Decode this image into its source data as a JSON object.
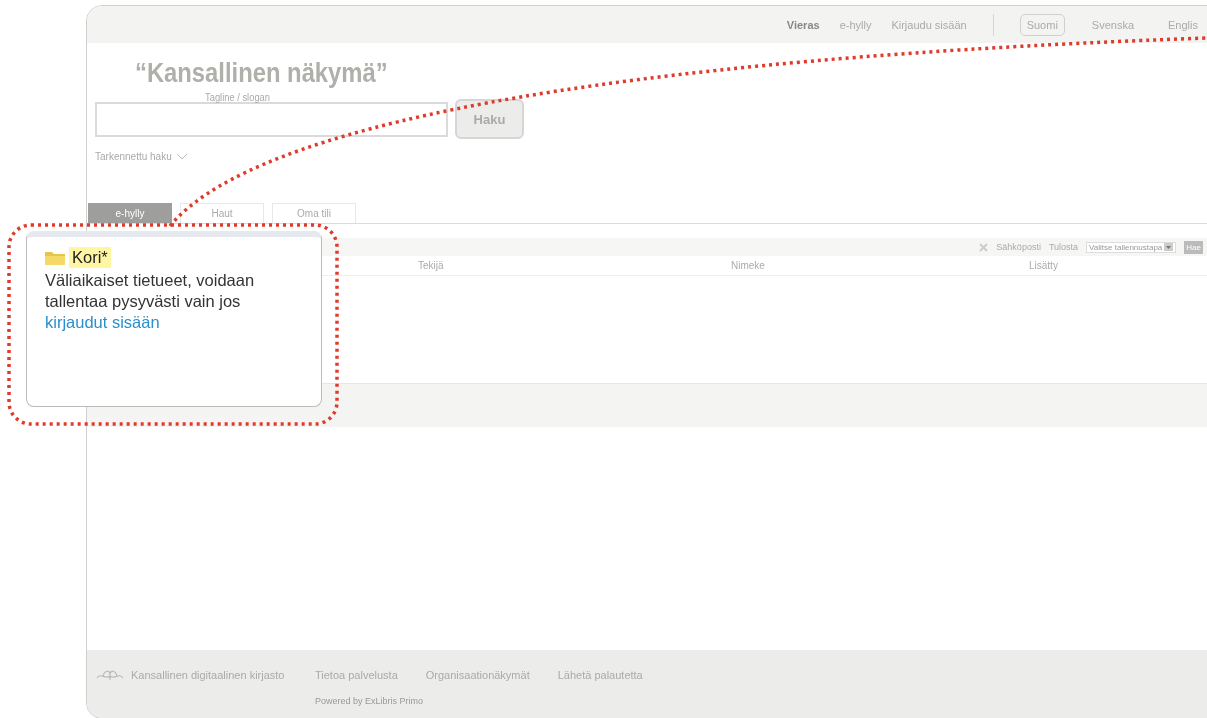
{
  "top_bar": {
    "links": [
      {
        "label": "Vieras",
        "kind": "user"
      },
      {
        "label": "e-hylly",
        "kind": "link"
      },
      {
        "label": "Kirjaudu sisään",
        "kind": "link"
      }
    ],
    "languages": [
      {
        "label": "Suomi",
        "selected": true
      },
      {
        "label": "Svenska",
        "selected": false
      },
      {
        "label": "Englis",
        "selected": false
      }
    ]
  },
  "header": {
    "title": "“Kansallinen näkymä”",
    "tagline": "Tagline / slogan"
  },
  "search": {
    "button": "Haku",
    "advanced": "Tarkennettu haku"
  },
  "tabs": [
    {
      "label": "e-hylly",
      "selected": true
    },
    {
      "label": "Haut",
      "selected": false
    },
    {
      "label": "Oma tili",
      "selected": false
    }
  ],
  "toolbar": {
    "actions": [
      "Sähköposti",
      "Tulosta"
    ],
    "save_select": "Valitse tallennustapa",
    "save_button": "Hae"
  },
  "table": {
    "columns": [
      "Tekijä",
      "Nimeke",
      "Lisätty"
    ]
  },
  "footer": {
    "brand": "Kansallinen digitaalinen kirjasto",
    "links": [
      "Tietoa palvelusta",
      "Organisaationäkymät",
      "Lähetä palautetta"
    ],
    "powered_by": "Powered by ExLibris Primo"
  },
  "callout": {
    "title": "Kori*",
    "text": "Väliaikaiset tietueet, voidaan tallentaa pysyvästi vain jos",
    "link": "kirjaudut sisään"
  }
}
